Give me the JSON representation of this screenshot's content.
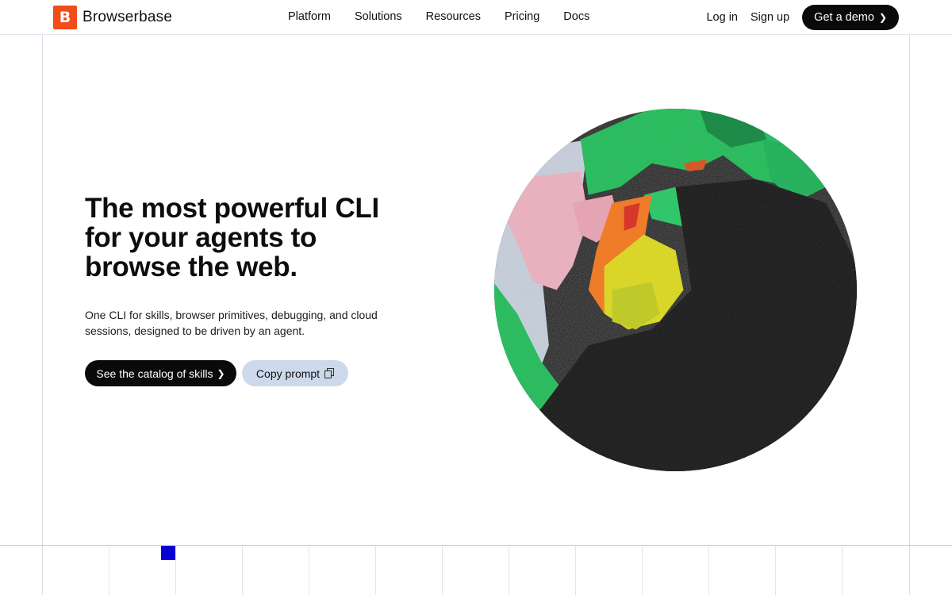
{
  "brand": {
    "logo_letter": "B",
    "name": "Browserbase",
    "accent": "#f04d1a"
  },
  "nav": {
    "items": [
      {
        "label": "Platform"
      },
      {
        "label": "Solutions"
      },
      {
        "label": "Resources"
      },
      {
        "label": "Pricing"
      },
      {
        "label": "Docs"
      }
    ],
    "login": "Log in",
    "signup": "Sign up",
    "demo": "Get a demo"
  },
  "hero": {
    "title": "The most powerful CLI for your agents to browse the web.",
    "subtitle": "One CLI for skills, browser primitives, debugging, and cloud sessions, designed to be driven by an agent.",
    "primary_cta": "See the catalog of skills",
    "secondary_cta": "Copy prompt"
  },
  "colors": {
    "cta_dark": "#0a0a0a",
    "cta_light": "#cdd9eb",
    "grid_marker": "#0a00d6"
  },
  "icons": {
    "chevron": "chevron-right-icon",
    "copy": "copy-icon",
    "globe": "globe-graphic"
  }
}
